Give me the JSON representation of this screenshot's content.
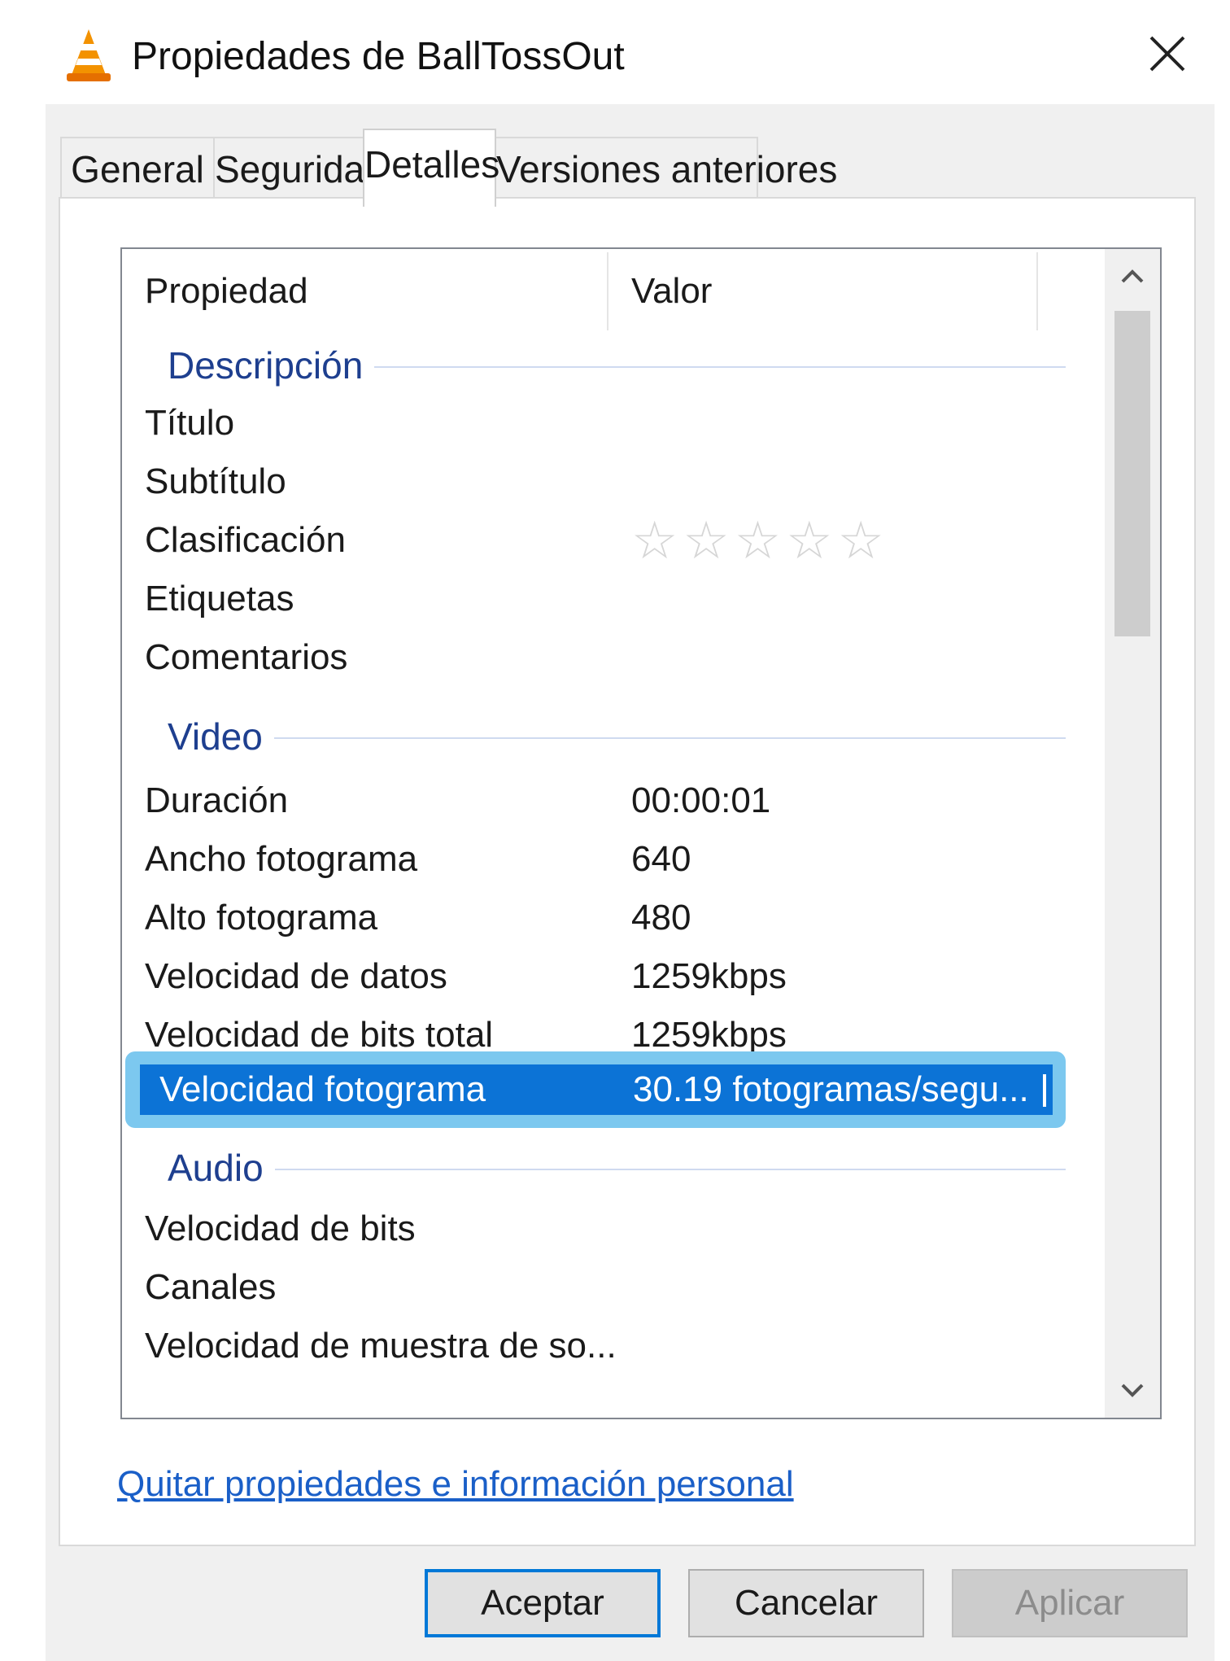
{
  "window": {
    "title": "Propiedades de BallTossOut",
    "app_icon": "vlc-cone-icon",
    "close_icon": "close-icon"
  },
  "tabs": [
    {
      "label": "General",
      "active": false
    },
    {
      "label": "Seguridad",
      "active": false
    },
    {
      "label": "Detalles",
      "active": true
    },
    {
      "label": "Versiones anteriores",
      "active": false
    }
  ],
  "list": {
    "columns": {
      "property": "Propiedad",
      "value": "Valor"
    },
    "groups": {
      "description": {
        "label": "Descripción",
        "rows": [
          {
            "key": "Título",
            "value": ""
          },
          {
            "key": "Subtítulo",
            "value": ""
          },
          {
            "key": "Clasificación",
            "rating": 0,
            "rating_max": 5
          },
          {
            "key": "Etiquetas",
            "value": ""
          },
          {
            "key": "Comentarios",
            "value": ""
          }
        ]
      },
      "video": {
        "label": "Video",
        "rows": [
          {
            "key": "Duración",
            "value": "00:00:01"
          },
          {
            "key": "Ancho fotograma",
            "value": "640"
          },
          {
            "key": "Alto fotograma",
            "value": "480"
          },
          {
            "key": "Velocidad de datos",
            "value": "1259kbps"
          },
          {
            "key": "Velocidad de bits total",
            "value": "1259kbps"
          },
          {
            "key": "Velocidad fotograma",
            "value": "30.19 fotogramas/segu...",
            "selected": true
          }
        ]
      },
      "audio": {
        "label": "Audio",
        "rows": [
          {
            "key": "Velocidad de bits",
            "value": ""
          },
          {
            "key": "Canales",
            "value": ""
          },
          {
            "key": "Velocidad de muestra de so...",
            "value": ""
          }
        ]
      }
    }
  },
  "remove_properties_link": "Quitar propiedades e información personal",
  "buttons": {
    "ok": "Aceptar",
    "cancel": "Cancelar",
    "apply": "Aplicar"
  },
  "colors": {
    "selection": "#0c73d6",
    "selection_highlight": "#7cc8ef",
    "group_header": "#1e3f8f",
    "link": "#1a5fc8"
  }
}
